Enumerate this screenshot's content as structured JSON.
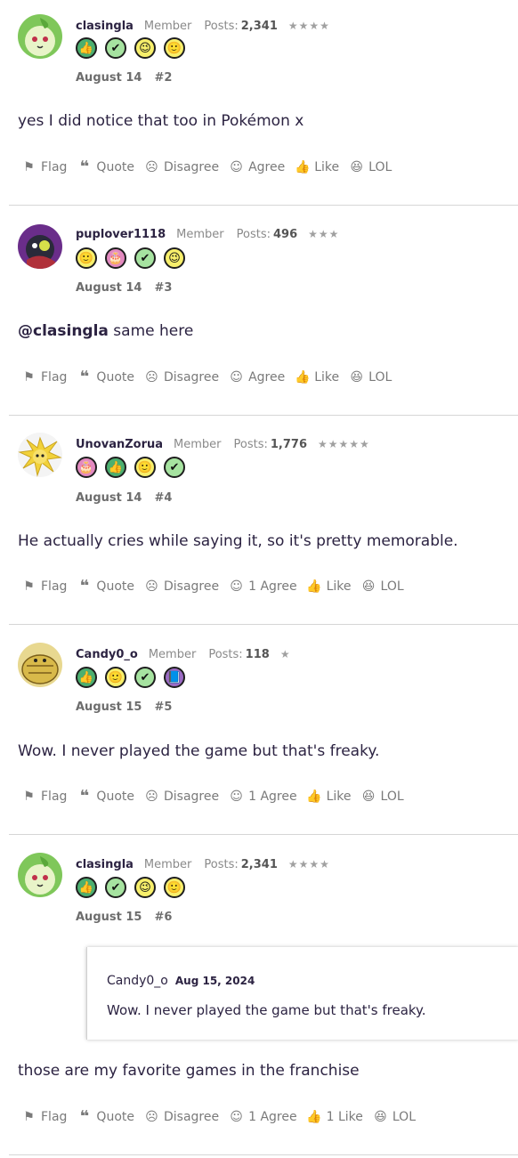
{
  "posts": [
    {
      "username": "clasingla",
      "role": "Member",
      "posts_label": "Posts:",
      "posts_count": "2,341",
      "stars": "★★★★",
      "date": "August 14",
      "number": "#2",
      "body": "yes I did notice that too in Pokémon x",
      "actions": {
        "flag": "Flag",
        "quote": "Quote",
        "disagree": "Disagree",
        "agree": "Agree",
        "like": "Like",
        "lol": "LOL"
      }
    },
    {
      "username": "puplover1118",
      "role": "Member",
      "posts_label": "Posts:",
      "posts_count": "496",
      "stars": "★★★",
      "date": "August 14",
      "number": "#3",
      "mention": "@clasingla",
      "body": " same here",
      "actions": {
        "flag": "Flag",
        "quote": "Quote",
        "disagree": "Disagree",
        "agree": "Agree",
        "like": "Like",
        "lol": "LOL"
      }
    },
    {
      "username": "UnovanZorua",
      "role": "Member",
      "posts_label": "Posts:",
      "posts_count": "1,776",
      "stars": "★★★★★",
      "date": "August 14",
      "number": "#4",
      "body": "He actually cries while saying it, so it's pretty memorable.",
      "actions": {
        "flag": "Flag",
        "quote": "Quote",
        "disagree": "Disagree",
        "agree": "1 Agree",
        "like": "Like",
        "lol": "LOL"
      }
    },
    {
      "username": "Candy0_o",
      "role": "Member",
      "posts_label": "Posts:",
      "posts_count": "118",
      "stars": "★",
      "date": "August 15",
      "number": "#5",
      "body": "Wow. I never played the game but that's freaky.",
      "actions": {
        "flag": "Flag",
        "quote": "Quote",
        "disagree": "Disagree",
        "agree": "1 Agree",
        "like": "Like",
        "lol": "LOL"
      }
    },
    {
      "username": "clasingla",
      "role": "Member",
      "posts_label": "Posts:",
      "posts_count": "2,341",
      "stars": "★★★★",
      "date": "August 15",
      "number": "#6",
      "quote": {
        "author": "Candy0_o",
        "date": "Aug 15, 2024",
        "text": "Wow. I never played the game but that's freaky."
      },
      "body": "those are my favorite games in the franchise",
      "actions": {
        "flag": "Flag",
        "quote": "Quote",
        "disagree": "Disagree",
        "agree": "1 Agree",
        "like": "1 Like",
        "lol": "LOL"
      }
    }
  ],
  "badge_icons": {
    "thumb": "thumbs-up-badge",
    "check": "check-badge",
    "smile": "smile-badge",
    "wink": "wink-badge",
    "cake": "cake-badge",
    "book": "book-badge"
  },
  "colors": {
    "text": "#2c2342",
    "muted": "#7a7a7a",
    "separator": "#d6d6d6",
    "badge_green": "#4caf6f",
    "badge_light_green": "#a6e3a0",
    "badge_yellow": "#f7ef6b",
    "badge_pink": "#e38ac0",
    "badge_purple": "#9b6bc4"
  }
}
